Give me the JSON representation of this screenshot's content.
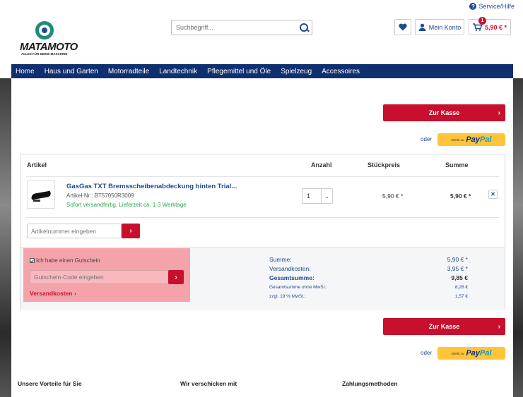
{
  "topbar": {
    "service_label": "Service/Hilfe"
  },
  "logo": {
    "word": "MATAMOTO",
    "tagline": "ALLES FÜR DEINE MASCHINE"
  },
  "header": {
    "search_placeholder": "Suchbegriff...",
    "account_label": "Mein Konto",
    "cart_count": "1",
    "cart_total": "5,90 € *"
  },
  "nav": [
    "Home",
    "Haus und Garten",
    "Motorradteile",
    "Landtechnik",
    "Pflegemittel und Öle",
    "Spielzeug",
    "Accessoires"
  ],
  "checkout": {
    "button_label": "Zur Kasse",
    "or_label": "oder",
    "paypal_prefix": "Direkt zu",
    "paypal_pay": "Pay",
    "paypal_pal": "Pal"
  },
  "cart": {
    "headers": {
      "article": "Artikel",
      "quantity": "Anzahl",
      "unit_price": "Stückpreis",
      "total": "Summe"
    },
    "item": {
      "name": "GasGas TXT Bremsscheibenabdeckung hinten Trial...",
      "article_no": "Artikel-Nr.: BT57050R3009",
      "availability": "Sofort versandfertig, Lieferzeit ca. 1-3 Werktage",
      "quantity": "1",
      "unit_price": "5,90 € *",
      "total": "5,90 € *"
    },
    "article_input_placeholder": "Artikelnummer eingeben"
  },
  "voucher": {
    "checkbox_label": "Ich habe einen Gutschein",
    "input_placeholder": "Gutschein-Code eingeben",
    "shipping_link": "Versandkosten"
  },
  "summary": {
    "sum_label": "Summe:",
    "sum_value": "5,90 € *",
    "shipping_label": "Versandkosten:",
    "shipping_value": "3,95 € *",
    "total_label": "Gesamtsumme:",
    "total_value": "9,85 €",
    "net_label": "Gesamtsumme ohne MwSt.:",
    "net_value": "8,28 €",
    "vat_label": "zzgl. 19 % MwSt.:",
    "vat_value": "1,57 €"
  },
  "footer": {
    "col1": "Unsere Vorteile für Sie",
    "col2": "Wir verschicken mit",
    "col3": "Zahlungsmethoden"
  }
}
